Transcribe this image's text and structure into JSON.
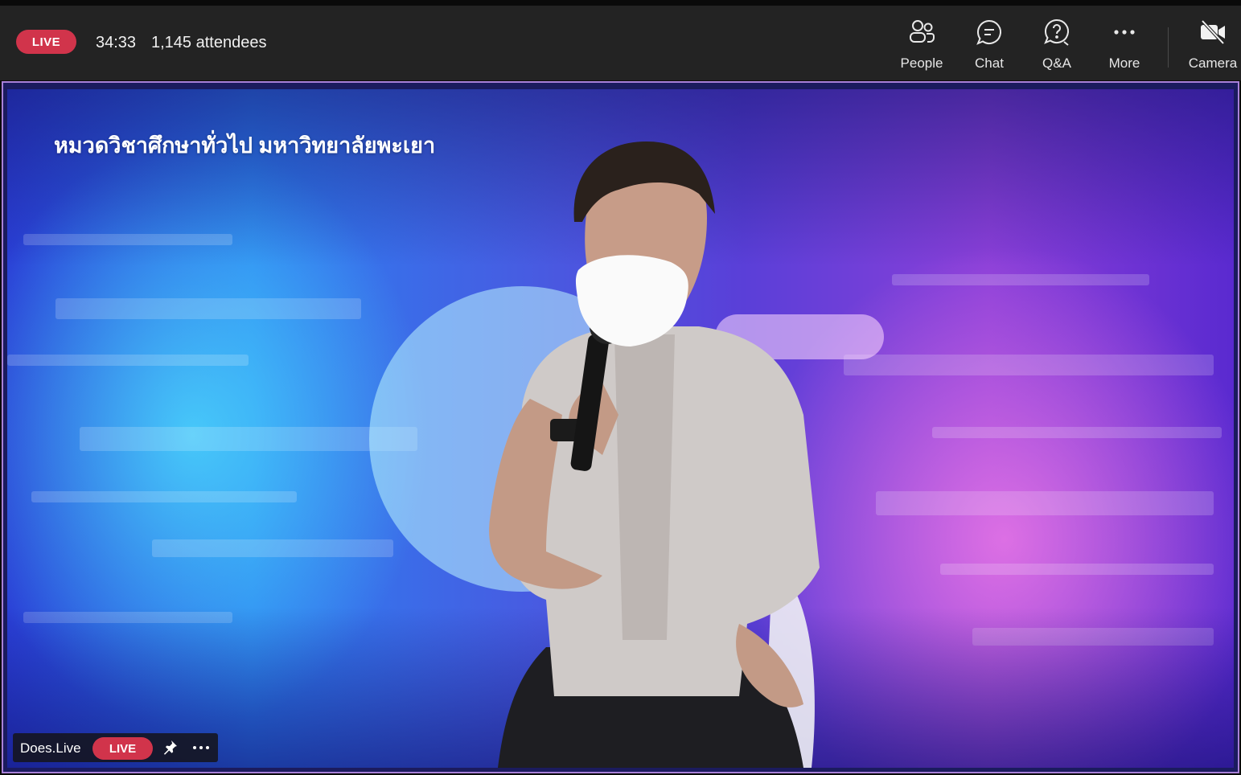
{
  "meeting": {
    "live_label": "LIVE",
    "elapsed": "34:33",
    "attendees": "1,145 attendees"
  },
  "toolbar": {
    "people_label": "People",
    "chat_label": "Chat",
    "qa_label": "Q&A",
    "more_label": "More",
    "camera_label": "Camera"
  },
  "stage": {
    "org_title": "หมวดวิชาศึกษาทั่วไป มหาวิทยาลัยพะเยา",
    "presenter_name": "Does.Live",
    "presenter_live_label": "LIVE"
  },
  "icons": {
    "people": "people-icon",
    "chat": "chat-icon",
    "qa": "qa-icon",
    "more": "more-icon",
    "camera": "camera-off-icon",
    "pin": "pin-icon",
    "options": "more-options-icon"
  },
  "colors": {
    "live_red": "#d1344b",
    "topbar_bg": "#232323",
    "stage_border": "#a880d8"
  }
}
